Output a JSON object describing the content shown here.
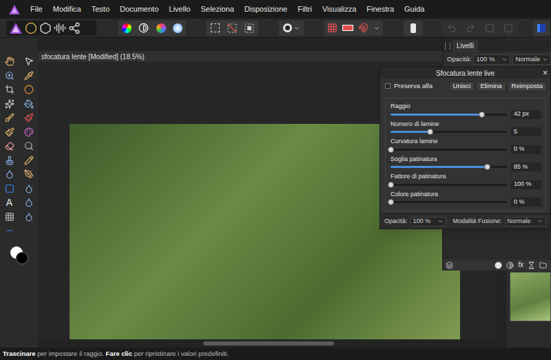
{
  "menu": [
    "File",
    "Modifica",
    "Testo",
    "Documento",
    "Livello",
    "Seleziona",
    "Disposizione",
    "Filtri",
    "Visualizza",
    "Finestra",
    "Guida"
  ],
  "tools": {
    "text_tool": "A"
  },
  "document_tab": {
    "title": "sfocatura lente [Modified] (18.5%)"
  },
  "layers_panel": {
    "tab": "Livelli",
    "opacity_label": "Opacità:",
    "opacity": "100 %",
    "blend": "Normale",
    "fx": "fx"
  },
  "dialog": {
    "title": "Sfocatura lente live",
    "close": "×",
    "preserve_alpha": {
      "label": "Preserva alfa",
      "checked": false
    },
    "buttons": [
      "Unisci",
      "Elimina",
      "Reimposta"
    ],
    "sliders": [
      {
        "label": "Raggio",
        "value": "42 px",
        "level": 0.78
      },
      {
        "label": "Numero di lamine",
        "value": "5",
        "level": 0.34
      },
      {
        "label": "Curvatura lamine",
        "value": "0 %",
        "level": 0
      },
      {
        "label": "Soglia patinatura",
        "value": "85 %",
        "level": 0.83
      },
      {
        "label": "Fattore di patinatura",
        "value": "100 %",
        "level": 0
      },
      {
        "label": "Colore patinatura",
        "value": "0 %",
        "level": 0
      }
    ],
    "opacity_label": "Opacità:",
    "opacity": "100 %",
    "blend_label": "Modalità Fusione:",
    "blend": "Normale"
  },
  "status_bar": [
    {
      "text": "Trascinare",
      "bold": true
    },
    {
      "text": " per impostare il raggio. ",
      "bold": false
    },
    {
      "text": "Fare clic",
      "bold": true
    },
    {
      "text": " per ripristinare i valori predefiniti.",
      "bold": false
    }
  ]
}
